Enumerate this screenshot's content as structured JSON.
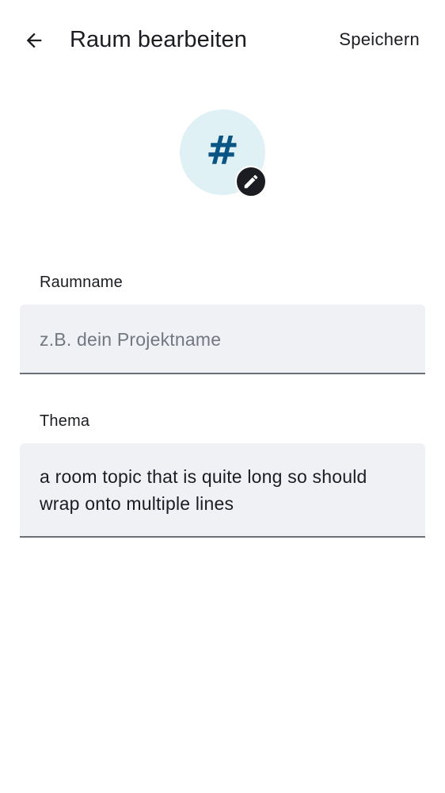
{
  "header": {
    "title": "Raum bearbeiten",
    "save_label": "Speichern",
    "back_icon": "arrow-left-icon"
  },
  "avatar": {
    "glyph": "#",
    "background": "#e0f1f6",
    "glyph_color": "#0b5585",
    "edit_icon": "pencil-icon"
  },
  "fields": {
    "room_name": {
      "label": "Raumname",
      "value": "",
      "placeholder": "z.B. dein Projektname"
    },
    "topic": {
      "label": "Thema",
      "value": "a room topic that is quite long so should wrap onto multiple lines",
      "placeholder": ""
    }
  },
  "colors": {
    "text": "#1b1d22",
    "field_background": "#f0f1f5",
    "field_underline": "#6b6f76",
    "placeholder": "#737780"
  }
}
